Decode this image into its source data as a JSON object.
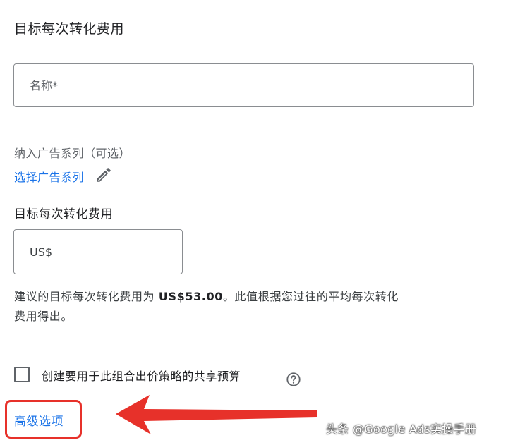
{
  "section": {
    "title": "目标每次转化费用"
  },
  "name_field": {
    "placeholder": "名称*",
    "value": ""
  },
  "campaign": {
    "label": "纳入广告系列（可选）",
    "link": "选择广告系列",
    "edit_icon": "pencil-icon"
  },
  "cpa": {
    "label": "目标每次转化费用",
    "currency_placeholder": "US$",
    "value": ""
  },
  "recommendation": {
    "prefix": "建议的目标每次转化费用为 ",
    "amount": "US$53.00",
    "suffix": "。此值根据您过往的平均每次转化费用得出。"
  },
  "shared_budget": {
    "label": "创建要用于此组合出价策略的共享预算",
    "checked": false,
    "help_icon": "help-circle-icon"
  },
  "advanced": {
    "link": "高级选项"
  },
  "annotation": {
    "highlight_color": "#e7312a",
    "arrow_icon": "red-arrow-left-icon"
  },
  "watermark": {
    "text": "头条 @Google Ads实操手册"
  },
  "colors": {
    "link": "#1a73e8",
    "text": "#202124",
    "secondary": "#5f6368",
    "annotation": "#e7312a"
  }
}
